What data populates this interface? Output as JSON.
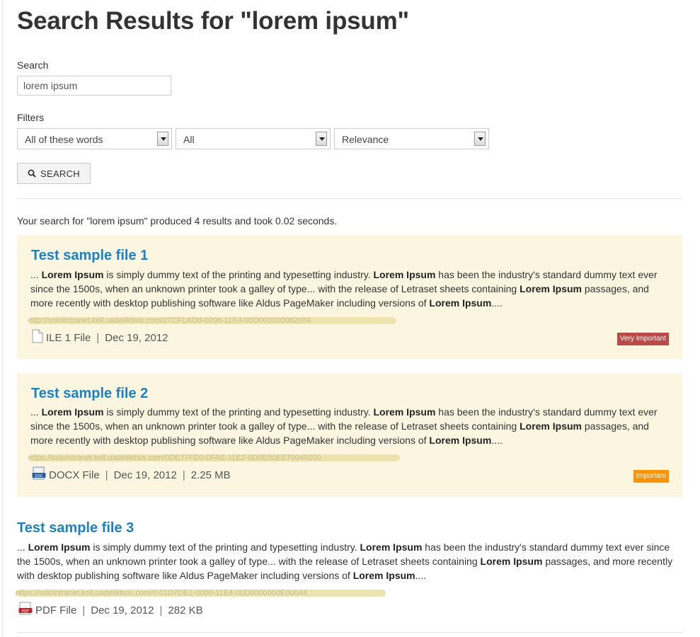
{
  "page": {
    "title": "Search Results for \"lorem ipsum\"",
    "search_label": "Search",
    "search_value": "lorem ipsum",
    "filters_label": "Filters",
    "filters": [
      "All of these words",
      "All",
      "Relevance"
    ],
    "search_button": "SEARCH",
    "summary": "Your search for \"lorem ipsum\" produced 4 results and took 0.02 seconds."
  },
  "colors": {
    "highlight_bg": "#fcf6e1",
    "title_link": "#1a82c4",
    "very_important": "#b94a48",
    "important": "#f89406"
  },
  "snippet_parts": {
    "p1": "... ",
    "b1": "Lorem Ipsum",
    "p2": " is simply dummy text of the printing and typesetting industry. ",
    "b2": "Lorem Ipsum",
    "p3": " has been the industry's standard dummy text ever since the 1500s, when an unknown printer took a galley of type... with the release of Letraset sheets containing ",
    "b3": "Lorem Ipsum",
    "p4": " passages, and more recently with desktop publishing software like Aldus PageMaker including versions of ",
    "b4": "Lorem Ipsum",
    "p5": "...."
  },
  "results": [
    {
      "title": "Test sample file 1",
      "url": "http://sololintranet.kell.uadeliktisis.com/2TCFLAD8-0096-11E4-00D000000082004",
      "file_type": "ILE 1 File",
      "date": "Dec 19, 2012",
      "size": "",
      "badge": "Very Important",
      "file_icon": "blank-file-icon"
    },
    {
      "title": "Test sample file 2",
      "url": "https://sololntranet.kell.uadeliktisis.com/0DE77FD0-0FAE-11E2-0D0E00EE70049200",
      "file_type": "DOCX File",
      "date": "Dec 19, 2012",
      "size": "2.25 MB",
      "badge": "Important",
      "file_icon": "docx-file-icon"
    },
    {
      "title": "Test sample file 3",
      "url": "https://sololntranet.kell.uadeliktisis.com/0-01D7DE1-0000-11E4-00D0000000E00044",
      "file_type": "PDF File",
      "date": "Dec 19, 2012",
      "size": "282 KB",
      "badge": "",
      "file_icon": "pdf-file-icon"
    }
  ]
}
